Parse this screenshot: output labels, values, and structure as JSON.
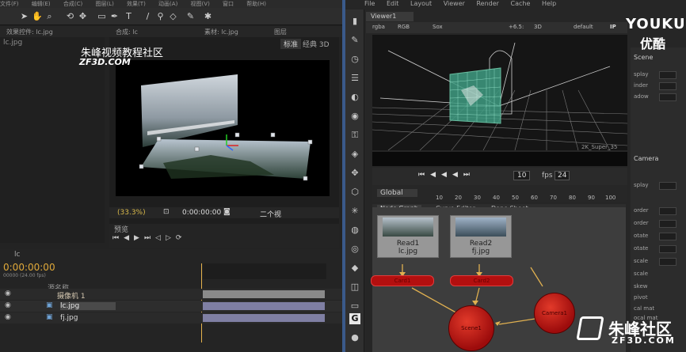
{
  "ae": {
    "menu": [
      "文件(F)",
      "编辑(E)",
      "合成(C)",
      "图层(L)",
      "效果(T)",
      "动画(A)",
      "视图(V)",
      "窗口",
      "帮助(H)"
    ],
    "left_tab": "效果控件: lc.jpg",
    "left_subtab": "lc.jpg",
    "comp_tab": "合成: lc",
    "footage_tab": "素材: lc.jpg",
    "layer_tab": "图层",
    "workspace_label": "标准",
    "workspace_label2": "经典 3D",
    "comp_name": "lc",
    "watermark": "朱峰视频教程社区",
    "watermark_site": "ZF3D.COM",
    "zoom": "(33.3%)",
    "time_display": "0:00:00:00",
    "view_mode": "二个视",
    "preview_tab": "预览",
    "timeline_tab": "lc",
    "timecode": "0:00:00:00",
    "timecode_sub": "00000 (24.00 fps)",
    "source_name_header": "源名称",
    "layers": [
      {
        "name": "摄像机 1"
      },
      {
        "name": "lc.jpg"
      },
      {
        "name": "fj.jpg"
      }
    ]
  },
  "nuke": {
    "menu": [
      "File",
      "Edit",
      "Layout",
      "Viewer",
      "Render",
      "Cache",
      "Help"
    ],
    "viewer_tab": "Viewer1",
    "toolbar": {
      "channel": "rgba",
      "color": "RGB",
      "compare": "Sox",
      "display_input": "+6.5:",
      "view_mode": "3D",
      "lut": "default",
      "ip": "IP"
    },
    "resolution_label": "2K_Super_35",
    "frame_value": "10",
    "fps_label": "fps",
    "fps_value": "24",
    "range_label": "Global",
    "ruler_ticks": [
      "10",
      "20",
      "30",
      "40",
      "50",
      "60",
      "70",
      "80",
      "90",
      "100"
    ],
    "panel_tabs": [
      "Node Graph",
      "Curve Editor",
      "Dope Sheet"
    ],
    "nodes": {
      "read1_label": "Read1",
      "read1_file": "lc.jpg",
      "read2_label": "Read2",
      "read2_file": "fj.jpg",
      "card1": "Card1",
      "card2": "Card2",
      "scene": "Scene1",
      "camera": "Camera1"
    },
    "properties": {
      "tab_scene": "Scene",
      "tab_camera": "Camera",
      "scene_rows": [
        "splay",
        "inder",
        "adow"
      ],
      "camera_rows": [
        "splay",
        "order",
        "order",
        "otate",
        "otate",
        "scale",
        "scale",
        "skew",
        "pivot",
        "cal mat",
        "ocal mat"
      ]
    }
  },
  "watermarks": {
    "youku": "YOUKU",
    "youku_cn": "优酷",
    "zf_cn": "朱峰社区",
    "zf_site": "ZF3D.COM"
  },
  "colors": {
    "node_red": "#b30f0f",
    "card_red": "#c41717",
    "selection_green": "#4dbb8a",
    "timeline_bar": "#7f7fa3"
  }
}
